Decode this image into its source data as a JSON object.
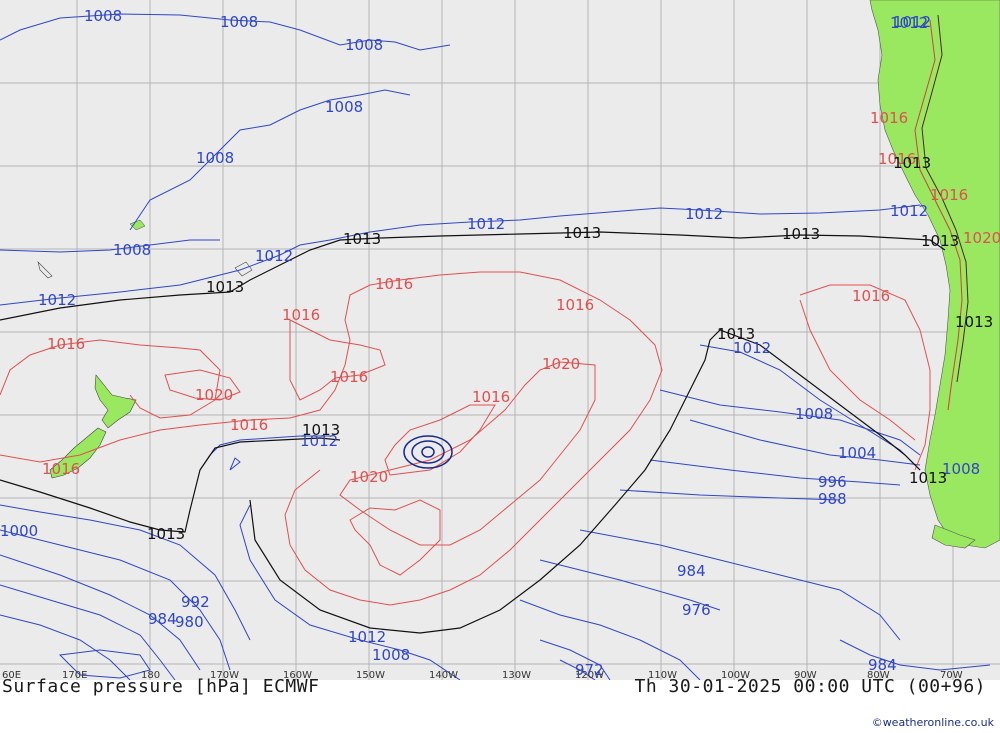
{
  "title": "Surface pressure [hPa] ECMWF",
  "valid_time": "Th 30-01-2025 00:00 UTC (00+96)",
  "credit": "©weatheronline.co.uk",
  "longitude_labels": [
    "60E",
    "170E",
    "180",
    "170W",
    "160W",
    "150W",
    "140W",
    "130W",
    "120W",
    "110W",
    "100W",
    "90W",
    "80W",
    "70W"
  ],
  "colors": {
    "ocean": "#ebebeb",
    "land": "#9ae85f",
    "grid": "#b4b4b4",
    "isobar_low": "#2f46c8",
    "isobar_high": "#e05050",
    "isobar_1013": "#111111"
  },
  "isobar_labels": {
    "blue": [
      "1008",
      "1008",
      "1008",
      "1008",
      "1008",
      "1008",
      "1012",
      "1012",
      "1012",
      "1012",
      "1012",
      "1012",
      "1012",
      "1012",
      "1008",
      "1004",
      "996",
      "988",
      "984",
      "976",
      "972",
      "984",
      "992",
      "984",
      "980",
      "1000",
      "1008",
      "1012",
      "1008",
      "1012"
    ],
    "red": [
      "1016",
      "1016",
      "1016",
      "1016",
      "1016",
      "1020",
      "1016",
      "1016",
      "1020",
      "1016",
      "1020",
      "1016",
      "1016",
      "1016",
      "1020",
      "1016"
    ],
    "black": [
      "1013",
      "1013",
      "1013",
      "1013",
      "1013",
      "1013",
      "1013",
      "1013",
      "1013",
      "1013",
      "1013"
    ]
  }
}
